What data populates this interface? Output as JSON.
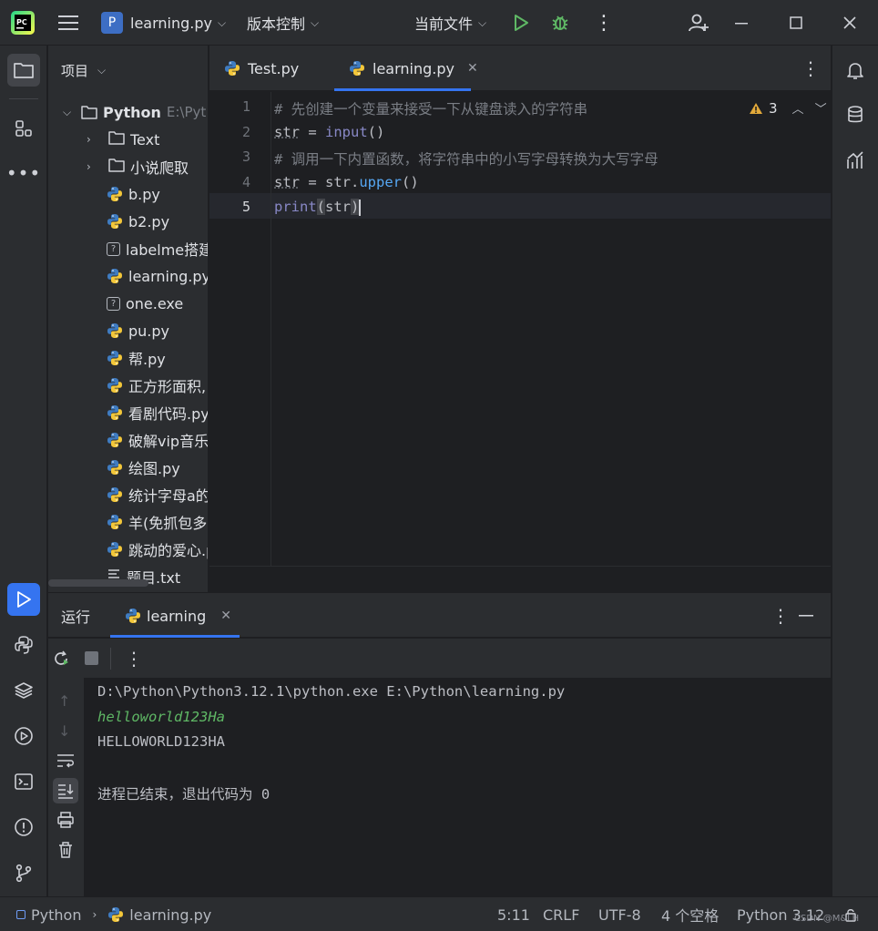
{
  "titlebar": {
    "app_logo": "PC",
    "project_initial": "P",
    "project_name": "learning.py",
    "vcs_label": "版本控制",
    "run_config": "当前文件"
  },
  "project_panel": {
    "title": "项目",
    "root": {
      "name": "Python",
      "path": "E:\\Pyt"
    },
    "items": [
      {
        "label": "Text",
        "type": "folder"
      },
      {
        "label": "小说爬取",
        "type": "folder"
      },
      {
        "label": "b.py",
        "type": "python"
      },
      {
        "label": "b2.py",
        "type": "python"
      },
      {
        "label": "labelme搭建",
        "type": "unknown"
      },
      {
        "label": "learning.py",
        "type": "python"
      },
      {
        "label": "one.exe",
        "type": "unknown"
      },
      {
        "label": "pu.py",
        "type": "python"
      },
      {
        "label": "帮.py",
        "type": "python"
      },
      {
        "label": "正方形面积,",
        "type": "python"
      },
      {
        "label": "看剧代码.py",
        "type": "python"
      },
      {
        "label": "破解vip音乐",
        "type": "python"
      },
      {
        "label": "绘图.py",
        "type": "python"
      },
      {
        "label": "统计字母a的",
        "type": "python"
      },
      {
        "label": "羊(免抓包多",
        "type": "python"
      },
      {
        "label": "跳动的爱心.p",
        "type": "python"
      },
      {
        "label": "题目.txt",
        "type": "text"
      }
    ]
  },
  "editor": {
    "tabs": [
      {
        "label": "Test.py",
        "active": false
      },
      {
        "label": "learning.py",
        "active": true
      }
    ],
    "warning_count": "3",
    "line_numbers": [
      "1",
      "2",
      "3",
      "4",
      "5"
    ],
    "lines": {
      "l1": "# 先创建一个变量来接受一下从键盘读入的字符串",
      "l2a": "str",
      "l2b": " = ",
      "l2c": "input",
      "l2d": "()",
      "l3": "# 调用一下内置函数，将字符串中的小写字母转换为大写字母",
      "l4a": "str",
      "l4b": " = str.",
      "l4c": "upper",
      "l4d": "()",
      "l5a": "print",
      "l5b": "(",
      "l5c": "str",
      "l5d": ")"
    }
  },
  "run_panel": {
    "title": "运行",
    "tab_label": "learning",
    "console": [
      "D:\\Python\\Python3.12.1\\python.exe E:\\Python\\learning.py",
      "helloworld123Ha",
      "HELLOWORLD123HA",
      "",
      "进程已结束，退出代码为 0"
    ]
  },
  "statusbar": {
    "breadcrumb_root": "Python",
    "breadcrumb_file": "learning.py",
    "position": "5:11",
    "line_ending": "CRLF",
    "encoding": "UTF-8",
    "indent": "4 个空格",
    "interpreter": "Python 3.12",
    "watermark": "CSDN @M&LH"
  },
  "colors": {
    "accent": "#3574f0",
    "run_green": "#5fb865",
    "comment": "#7a7e85",
    "keyword_blue": "#56a8f5",
    "builtin": "#8888c6",
    "console_input": "#5fb865",
    "warning": "#e2a93a"
  }
}
